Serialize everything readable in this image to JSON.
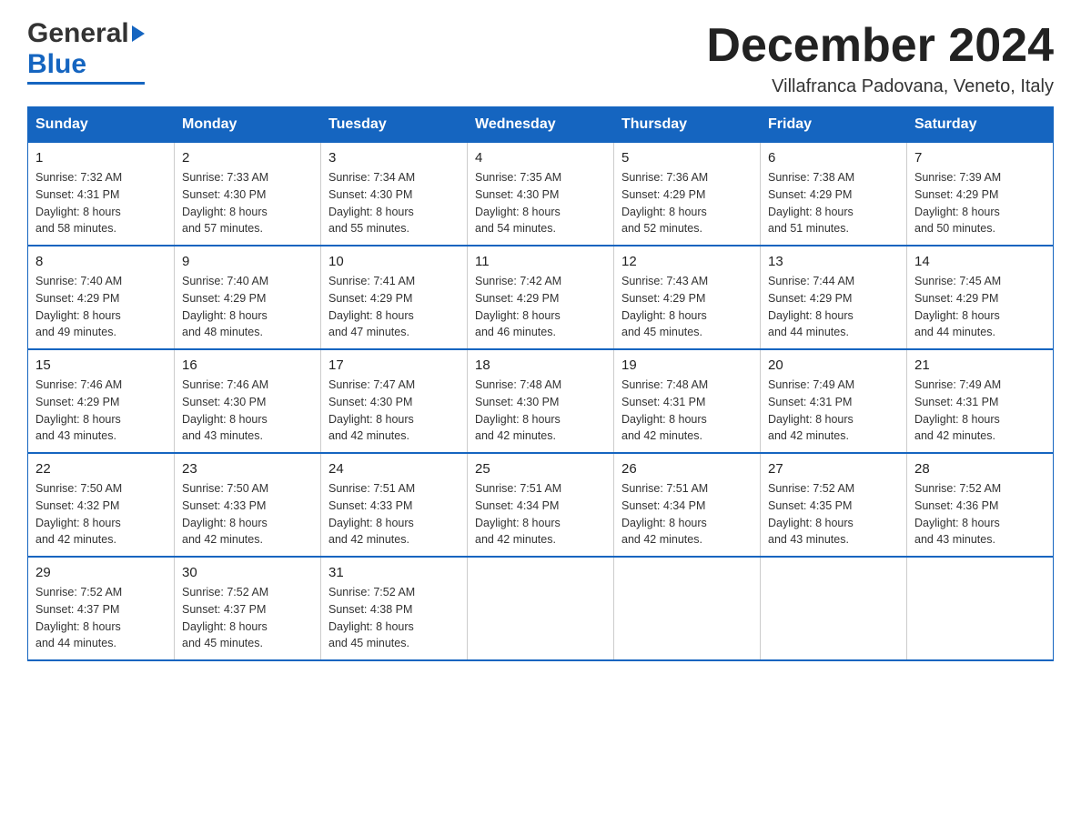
{
  "header": {
    "logo_general": "General",
    "logo_blue": "Blue",
    "month_title": "December 2024",
    "location": "Villafranca Padovana, Veneto, Italy"
  },
  "weekdays": [
    "Sunday",
    "Monday",
    "Tuesday",
    "Wednesday",
    "Thursday",
    "Friday",
    "Saturday"
  ],
  "weeks": [
    [
      {
        "day": "1",
        "sunrise": "7:32 AM",
        "sunset": "4:31 PM",
        "daylight": "8 hours and 58 minutes."
      },
      {
        "day": "2",
        "sunrise": "7:33 AM",
        "sunset": "4:30 PM",
        "daylight": "8 hours and 57 minutes."
      },
      {
        "day": "3",
        "sunrise": "7:34 AM",
        "sunset": "4:30 PM",
        "daylight": "8 hours and 55 minutes."
      },
      {
        "day": "4",
        "sunrise": "7:35 AM",
        "sunset": "4:30 PM",
        "daylight": "8 hours and 54 minutes."
      },
      {
        "day": "5",
        "sunrise": "7:36 AM",
        "sunset": "4:29 PM",
        "daylight": "8 hours and 52 minutes."
      },
      {
        "day": "6",
        "sunrise": "7:38 AM",
        "sunset": "4:29 PM",
        "daylight": "8 hours and 51 minutes."
      },
      {
        "day": "7",
        "sunrise": "7:39 AM",
        "sunset": "4:29 PM",
        "daylight": "8 hours and 50 minutes."
      }
    ],
    [
      {
        "day": "8",
        "sunrise": "7:40 AM",
        "sunset": "4:29 PM",
        "daylight": "8 hours and 49 minutes."
      },
      {
        "day": "9",
        "sunrise": "7:40 AM",
        "sunset": "4:29 PM",
        "daylight": "8 hours and 48 minutes."
      },
      {
        "day": "10",
        "sunrise": "7:41 AM",
        "sunset": "4:29 PM",
        "daylight": "8 hours and 47 minutes."
      },
      {
        "day": "11",
        "sunrise": "7:42 AM",
        "sunset": "4:29 PM",
        "daylight": "8 hours and 46 minutes."
      },
      {
        "day": "12",
        "sunrise": "7:43 AM",
        "sunset": "4:29 PM",
        "daylight": "8 hours and 45 minutes."
      },
      {
        "day": "13",
        "sunrise": "7:44 AM",
        "sunset": "4:29 PM",
        "daylight": "8 hours and 44 minutes."
      },
      {
        "day": "14",
        "sunrise": "7:45 AM",
        "sunset": "4:29 PM",
        "daylight": "8 hours and 44 minutes."
      }
    ],
    [
      {
        "day": "15",
        "sunrise": "7:46 AM",
        "sunset": "4:29 PM",
        "daylight": "8 hours and 43 minutes."
      },
      {
        "day": "16",
        "sunrise": "7:46 AM",
        "sunset": "4:30 PM",
        "daylight": "8 hours and 43 minutes."
      },
      {
        "day": "17",
        "sunrise": "7:47 AM",
        "sunset": "4:30 PM",
        "daylight": "8 hours and 42 minutes."
      },
      {
        "day": "18",
        "sunrise": "7:48 AM",
        "sunset": "4:30 PM",
        "daylight": "8 hours and 42 minutes."
      },
      {
        "day": "19",
        "sunrise": "7:48 AM",
        "sunset": "4:31 PM",
        "daylight": "8 hours and 42 minutes."
      },
      {
        "day": "20",
        "sunrise": "7:49 AM",
        "sunset": "4:31 PM",
        "daylight": "8 hours and 42 minutes."
      },
      {
        "day": "21",
        "sunrise": "7:49 AM",
        "sunset": "4:31 PM",
        "daylight": "8 hours and 42 minutes."
      }
    ],
    [
      {
        "day": "22",
        "sunrise": "7:50 AM",
        "sunset": "4:32 PM",
        "daylight": "8 hours and 42 minutes."
      },
      {
        "day": "23",
        "sunrise": "7:50 AM",
        "sunset": "4:33 PM",
        "daylight": "8 hours and 42 minutes."
      },
      {
        "day": "24",
        "sunrise": "7:51 AM",
        "sunset": "4:33 PM",
        "daylight": "8 hours and 42 minutes."
      },
      {
        "day": "25",
        "sunrise": "7:51 AM",
        "sunset": "4:34 PM",
        "daylight": "8 hours and 42 minutes."
      },
      {
        "day": "26",
        "sunrise": "7:51 AM",
        "sunset": "4:34 PM",
        "daylight": "8 hours and 42 minutes."
      },
      {
        "day": "27",
        "sunrise": "7:52 AM",
        "sunset": "4:35 PM",
        "daylight": "8 hours and 43 minutes."
      },
      {
        "day": "28",
        "sunrise": "7:52 AM",
        "sunset": "4:36 PM",
        "daylight": "8 hours and 43 minutes."
      }
    ],
    [
      {
        "day": "29",
        "sunrise": "7:52 AM",
        "sunset": "4:37 PM",
        "daylight": "8 hours and 44 minutes."
      },
      {
        "day": "30",
        "sunrise": "7:52 AM",
        "sunset": "4:37 PM",
        "daylight": "8 hours and 45 minutes."
      },
      {
        "day": "31",
        "sunrise": "7:52 AM",
        "sunset": "4:38 PM",
        "daylight": "8 hours and 45 minutes."
      },
      null,
      null,
      null,
      null
    ]
  ]
}
